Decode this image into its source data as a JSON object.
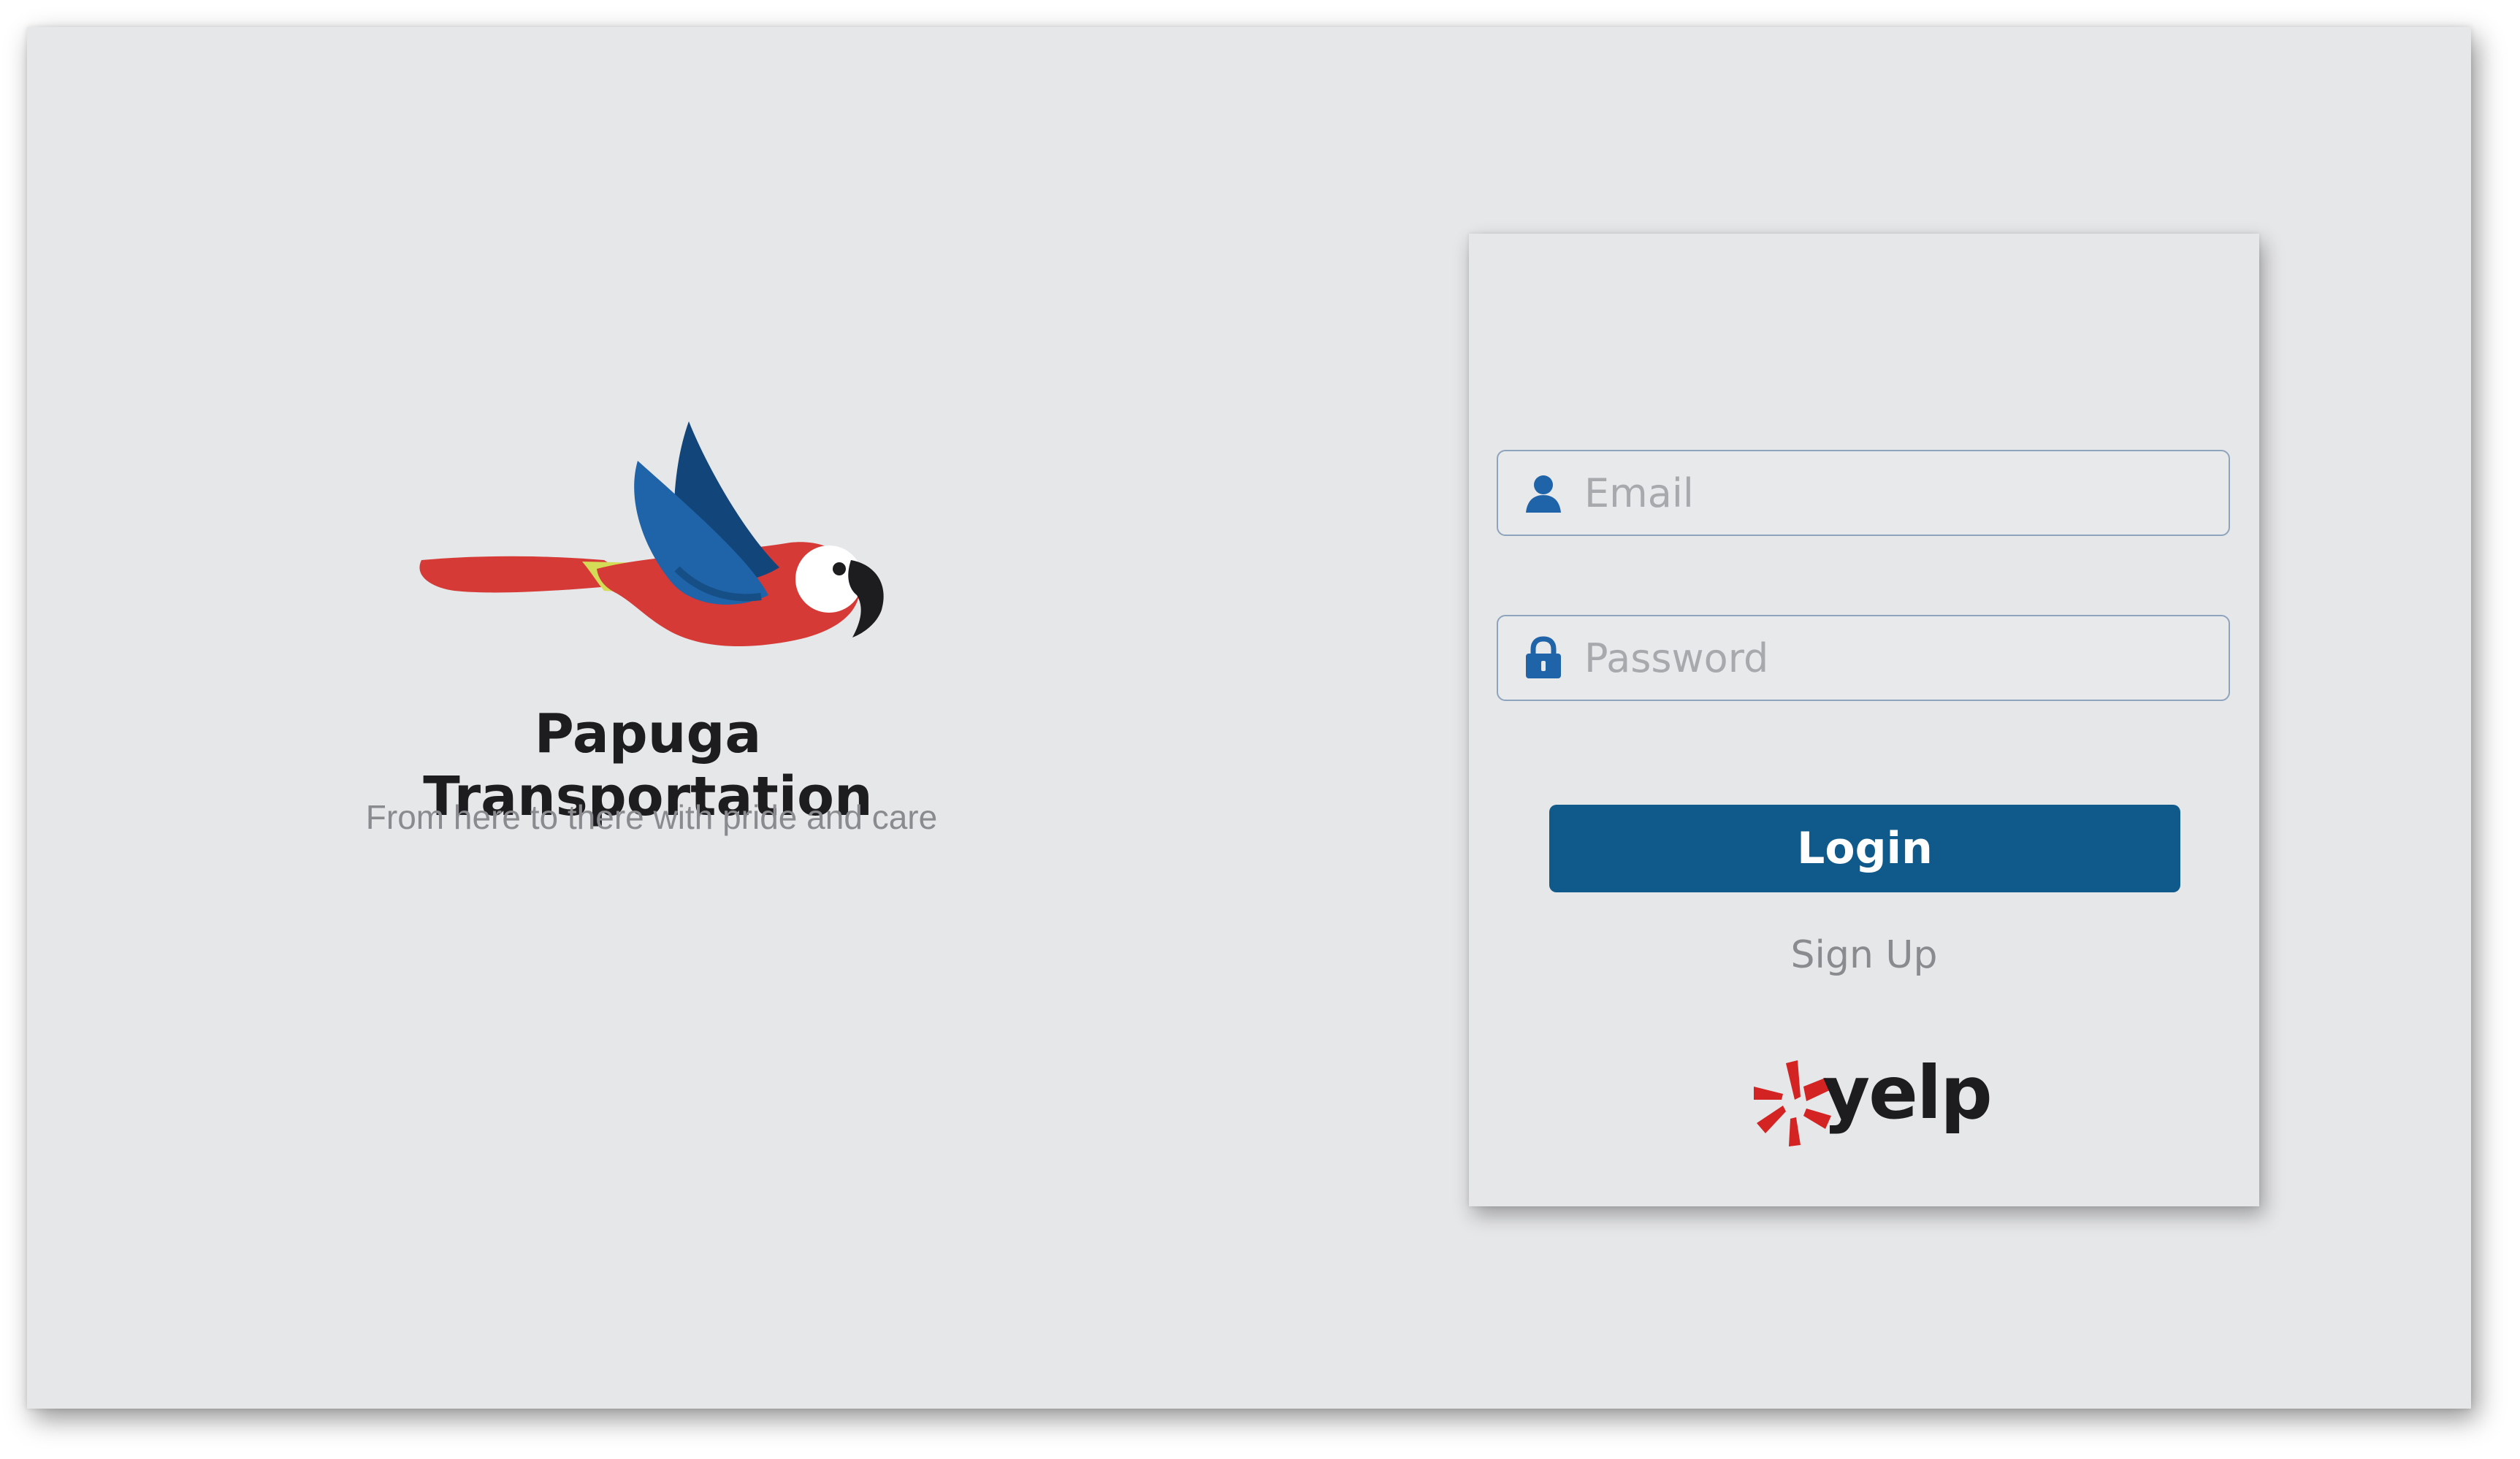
{
  "brand": {
    "name": "Papuga Transportation",
    "tagline": "From here to there with pride and care",
    "logo_icon": "parrot-icon",
    "colors": {
      "red": "#d63a36",
      "blue": "#1f63a8",
      "dark_blue": "#12467a",
      "yellow": "#d4dc57"
    }
  },
  "login": {
    "email_placeholder": "Email",
    "email_icon": "user-icon",
    "password_placeholder": "Password",
    "password_icon": "lock-icon",
    "login_label": "Login",
    "signup_label": "Sign Up",
    "accent_color": "#0f5a8a"
  },
  "partner": {
    "name": "yelp",
    "icon": "yelp-burst-icon",
    "color": "#d32323"
  }
}
